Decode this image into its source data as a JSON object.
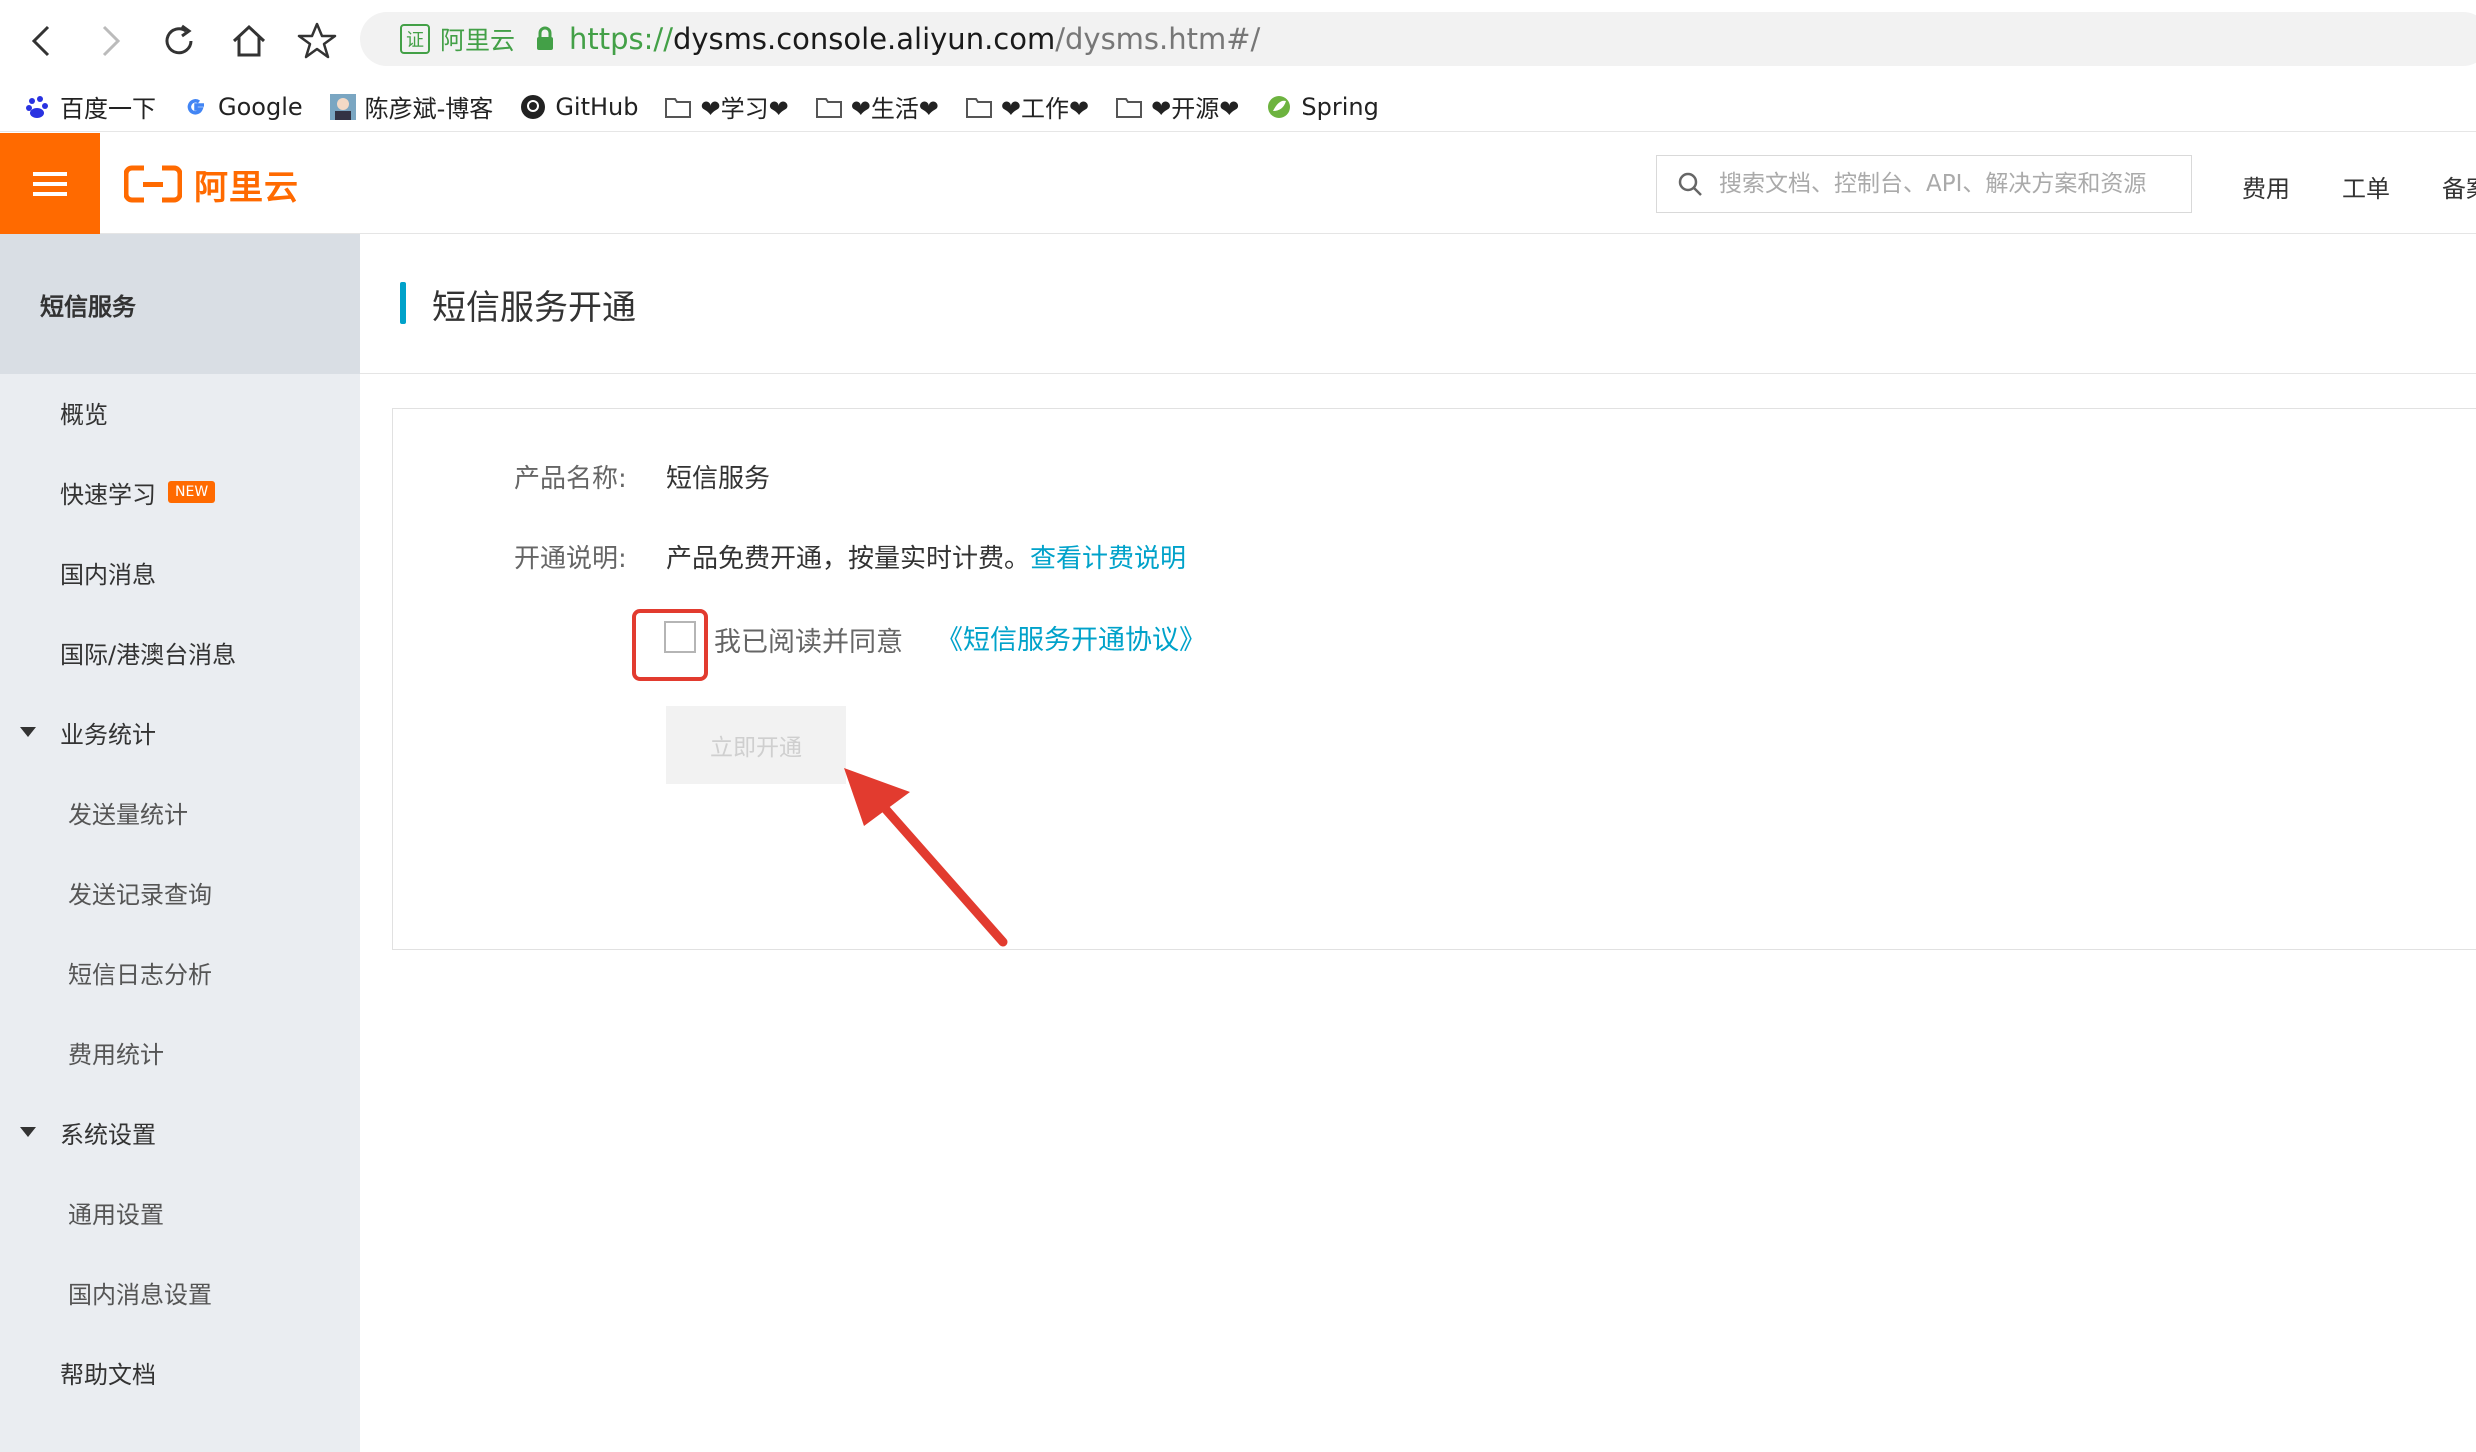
{
  "browser": {
    "url_site_label": "阿里云",
    "url_cert_glyph": "证",
    "url_scheme": "https://",
    "url_host": "dysms.console.aliyun.com",
    "url_path": "/dysms.htm#/",
    "bookmarks": [
      {
        "label": "百度一下",
        "icon": "baidu-icon"
      },
      {
        "label": "Google",
        "icon": "google-icon"
      },
      {
        "label": "陈彦斌-博客",
        "icon": "avatar-icon"
      },
      {
        "label": "GitHub",
        "icon": "github-icon"
      },
      {
        "label": "❤学习❤",
        "icon": "folder-icon"
      },
      {
        "label": "❤生活❤",
        "icon": "folder-icon"
      },
      {
        "label": "❤工作❤",
        "icon": "folder-icon"
      },
      {
        "label": "❤开源❤",
        "icon": "folder-icon"
      },
      {
        "label": "Spring",
        "icon": "spring-icon"
      }
    ]
  },
  "topbar": {
    "brand": "阿里云",
    "search_placeholder": "搜索文档、控制台、API、解决方案和资源",
    "links": [
      "费用",
      "工单",
      "备案"
    ]
  },
  "sidebar": {
    "title": "短信服务",
    "items": [
      {
        "label": "概览"
      },
      {
        "label": "快速学习",
        "badge": "NEW"
      },
      {
        "label": "国内消息"
      },
      {
        "label": "国际/港澳台消息"
      },
      {
        "label": "业务统计",
        "expanded": true
      },
      {
        "label": "发送量统计"
      },
      {
        "label": "发送记录查询"
      },
      {
        "label": "短信日志分析"
      },
      {
        "label": "费用统计"
      },
      {
        "label": "系统设置",
        "expanded": true
      },
      {
        "label": "通用设置"
      },
      {
        "label": "国内消息设置"
      },
      {
        "label": "帮助文档"
      }
    ]
  },
  "main": {
    "title": "短信服务开通",
    "product_label": "产品名称:",
    "product_value": "短信服务",
    "desc_label": "开通说明:",
    "desc_value": "产品免费开通，按量实时计费。",
    "desc_link": "查看计费说明",
    "agree_text": "我已阅读并同意",
    "agree_link": "《短信服务开通协议》",
    "agree_checked": false,
    "open_button": "立即开通"
  },
  "colors": {
    "brand_orange": "#ff6a00",
    "link_blue": "#00a2ca",
    "annotation_red": "#e23b2f"
  }
}
